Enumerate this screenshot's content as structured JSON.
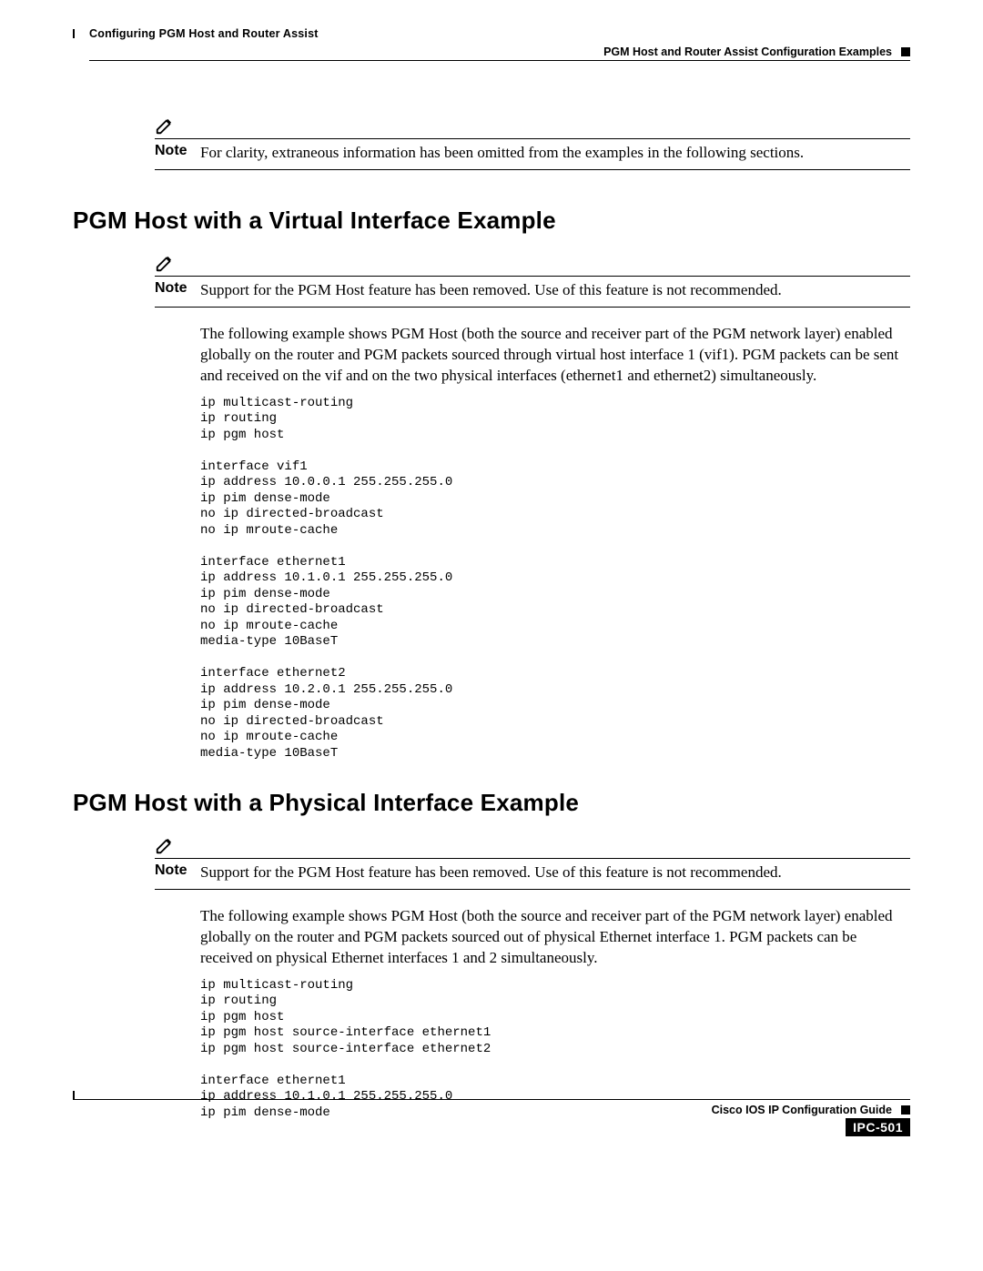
{
  "header": {
    "chapter": "Configuring PGM Host and Router Assist",
    "section": "PGM Host and Router Assist Configuration Examples"
  },
  "note1": {
    "label": "Note",
    "text": "For clarity, extraneous information has been omitted from the examples in the following sections."
  },
  "section1": {
    "heading": "PGM Host with a Virtual Interface Example",
    "note": {
      "label": "Note",
      "text": "Support for the PGM Host feature has been removed. Use of this feature is not recommended."
    },
    "body": "The following example shows PGM Host (both the source and receiver part of the PGM network layer) enabled globally on the router and PGM packets sourced through virtual host interface 1 (vif1). PGM packets can be sent and received on the vif and on the two physical interfaces (ethernet1 and ethernet2) simultaneously.",
    "code": "ip multicast-routing\nip routing\nip pgm host\n\ninterface vif1\nip address 10.0.0.1 255.255.255.0\nip pim dense-mode\nno ip directed-broadcast\nno ip mroute-cache\n\ninterface ethernet1\nip address 10.1.0.1 255.255.255.0\nip pim dense-mode\nno ip directed-broadcast\nno ip mroute-cache\nmedia-type 10BaseT\n\ninterface ethernet2\nip address 10.2.0.1 255.255.255.0\nip pim dense-mode\nno ip directed-broadcast\nno ip mroute-cache\nmedia-type 10BaseT"
  },
  "section2": {
    "heading": "PGM Host with a Physical Interface Example",
    "note": {
      "label": "Note",
      "text": "Support for the PGM Host feature has been removed. Use of this feature is not recommended."
    },
    "body": "The following example shows PGM Host (both the source and receiver part of the PGM network layer) enabled globally on the router and PGM packets sourced out of physical Ethernet interface 1. PGM packets can be received on physical Ethernet interfaces 1 and 2 simultaneously.",
    "code": "ip multicast-routing\nip routing\nip pgm host\nip pgm host source-interface ethernet1\nip pgm host source-interface ethernet2\n\ninterface ethernet1\nip address 10.1.0.1 255.255.255.0\nip pim dense-mode"
  },
  "footer": {
    "title": "Cisco IOS IP Configuration Guide",
    "page": "IPC-501"
  }
}
